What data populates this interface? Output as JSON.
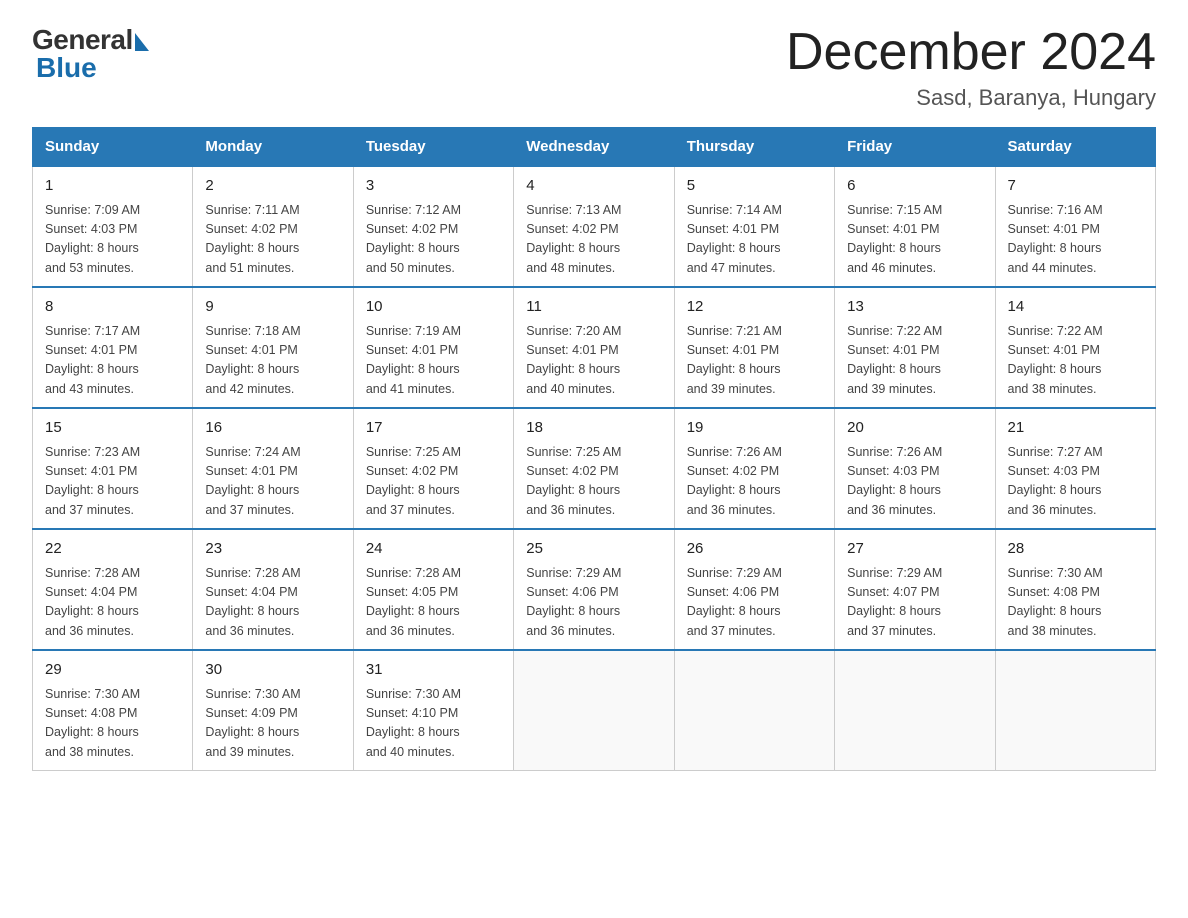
{
  "header": {
    "logo_general": "General",
    "logo_blue": "Blue",
    "month_title": "December 2024",
    "location": "Sasd, Baranya, Hungary"
  },
  "days_of_week": [
    "Sunday",
    "Monday",
    "Tuesday",
    "Wednesday",
    "Thursday",
    "Friday",
    "Saturday"
  ],
  "weeks": [
    [
      {
        "day": "1",
        "info": "Sunrise: 7:09 AM\nSunset: 4:03 PM\nDaylight: 8 hours\nand 53 minutes."
      },
      {
        "day": "2",
        "info": "Sunrise: 7:11 AM\nSunset: 4:02 PM\nDaylight: 8 hours\nand 51 minutes."
      },
      {
        "day": "3",
        "info": "Sunrise: 7:12 AM\nSunset: 4:02 PM\nDaylight: 8 hours\nand 50 minutes."
      },
      {
        "day": "4",
        "info": "Sunrise: 7:13 AM\nSunset: 4:02 PM\nDaylight: 8 hours\nand 48 minutes."
      },
      {
        "day": "5",
        "info": "Sunrise: 7:14 AM\nSunset: 4:01 PM\nDaylight: 8 hours\nand 47 minutes."
      },
      {
        "day": "6",
        "info": "Sunrise: 7:15 AM\nSunset: 4:01 PM\nDaylight: 8 hours\nand 46 minutes."
      },
      {
        "day": "7",
        "info": "Sunrise: 7:16 AM\nSunset: 4:01 PM\nDaylight: 8 hours\nand 44 minutes."
      }
    ],
    [
      {
        "day": "8",
        "info": "Sunrise: 7:17 AM\nSunset: 4:01 PM\nDaylight: 8 hours\nand 43 minutes."
      },
      {
        "day": "9",
        "info": "Sunrise: 7:18 AM\nSunset: 4:01 PM\nDaylight: 8 hours\nand 42 minutes."
      },
      {
        "day": "10",
        "info": "Sunrise: 7:19 AM\nSunset: 4:01 PM\nDaylight: 8 hours\nand 41 minutes."
      },
      {
        "day": "11",
        "info": "Sunrise: 7:20 AM\nSunset: 4:01 PM\nDaylight: 8 hours\nand 40 minutes."
      },
      {
        "day": "12",
        "info": "Sunrise: 7:21 AM\nSunset: 4:01 PM\nDaylight: 8 hours\nand 39 minutes."
      },
      {
        "day": "13",
        "info": "Sunrise: 7:22 AM\nSunset: 4:01 PM\nDaylight: 8 hours\nand 39 minutes."
      },
      {
        "day": "14",
        "info": "Sunrise: 7:22 AM\nSunset: 4:01 PM\nDaylight: 8 hours\nand 38 minutes."
      }
    ],
    [
      {
        "day": "15",
        "info": "Sunrise: 7:23 AM\nSunset: 4:01 PM\nDaylight: 8 hours\nand 37 minutes."
      },
      {
        "day": "16",
        "info": "Sunrise: 7:24 AM\nSunset: 4:01 PM\nDaylight: 8 hours\nand 37 minutes."
      },
      {
        "day": "17",
        "info": "Sunrise: 7:25 AM\nSunset: 4:02 PM\nDaylight: 8 hours\nand 37 minutes."
      },
      {
        "day": "18",
        "info": "Sunrise: 7:25 AM\nSunset: 4:02 PM\nDaylight: 8 hours\nand 36 minutes."
      },
      {
        "day": "19",
        "info": "Sunrise: 7:26 AM\nSunset: 4:02 PM\nDaylight: 8 hours\nand 36 minutes."
      },
      {
        "day": "20",
        "info": "Sunrise: 7:26 AM\nSunset: 4:03 PM\nDaylight: 8 hours\nand 36 minutes."
      },
      {
        "day": "21",
        "info": "Sunrise: 7:27 AM\nSunset: 4:03 PM\nDaylight: 8 hours\nand 36 minutes."
      }
    ],
    [
      {
        "day": "22",
        "info": "Sunrise: 7:28 AM\nSunset: 4:04 PM\nDaylight: 8 hours\nand 36 minutes."
      },
      {
        "day": "23",
        "info": "Sunrise: 7:28 AM\nSunset: 4:04 PM\nDaylight: 8 hours\nand 36 minutes."
      },
      {
        "day": "24",
        "info": "Sunrise: 7:28 AM\nSunset: 4:05 PM\nDaylight: 8 hours\nand 36 minutes."
      },
      {
        "day": "25",
        "info": "Sunrise: 7:29 AM\nSunset: 4:06 PM\nDaylight: 8 hours\nand 36 minutes."
      },
      {
        "day": "26",
        "info": "Sunrise: 7:29 AM\nSunset: 4:06 PM\nDaylight: 8 hours\nand 37 minutes."
      },
      {
        "day": "27",
        "info": "Sunrise: 7:29 AM\nSunset: 4:07 PM\nDaylight: 8 hours\nand 37 minutes."
      },
      {
        "day": "28",
        "info": "Sunrise: 7:30 AM\nSunset: 4:08 PM\nDaylight: 8 hours\nand 38 minutes."
      }
    ],
    [
      {
        "day": "29",
        "info": "Sunrise: 7:30 AM\nSunset: 4:08 PM\nDaylight: 8 hours\nand 38 minutes."
      },
      {
        "day": "30",
        "info": "Sunrise: 7:30 AM\nSunset: 4:09 PM\nDaylight: 8 hours\nand 39 minutes."
      },
      {
        "day": "31",
        "info": "Sunrise: 7:30 AM\nSunset: 4:10 PM\nDaylight: 8 hours\nand 40 minutes."
      },
      {
        "day": "",
        "info": ""
      },
      {
        "day": "",
        "info": ""
      },
      {
        "day": "",
        "info": ""
      },
      {
        "day": "",
        "info": ""
      }
    ]
  ]
}
